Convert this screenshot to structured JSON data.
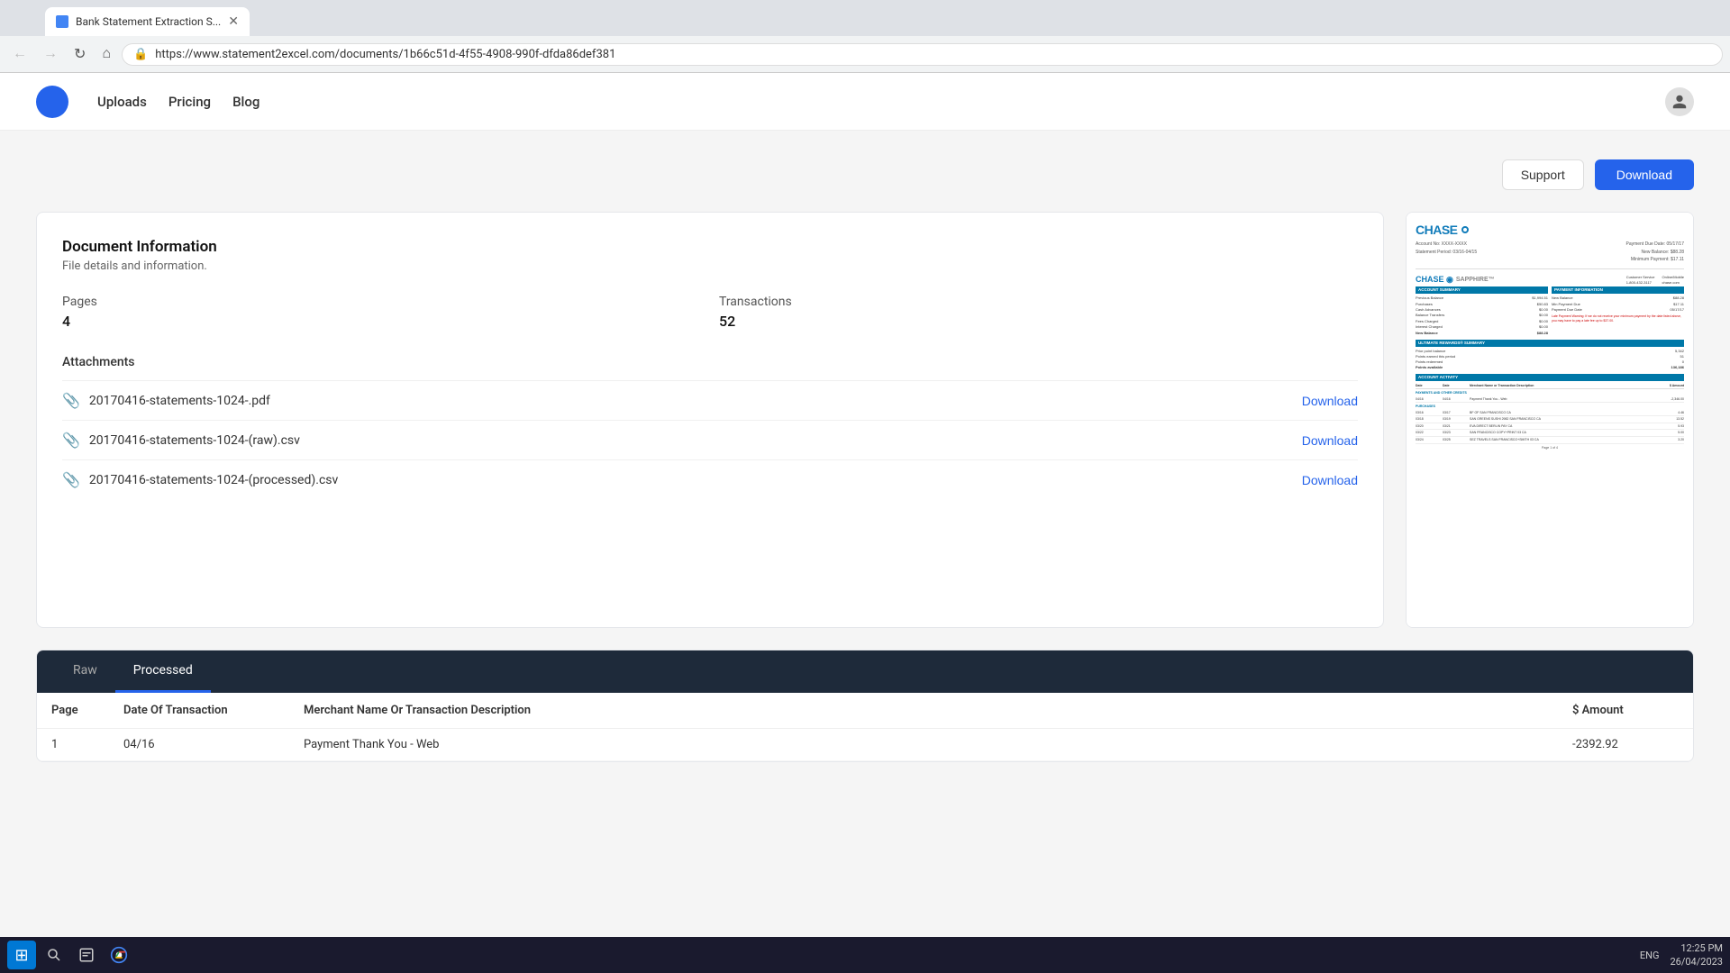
{
  "browser": {
    "tab_title": "Bank Statement Extraction S...",
    "url": "https://www.statement2excel.com/documents/1b66c51d-4f55-4908-990f-dfda86def381",
    "nav": {
      "back": "←",
      "forward": "→",
      "reload": "↻",
      "home": "⌂"
    }
  },
  "navbar": {
    "links": [
      {
        "id": "uploads",
        "label": "Uploads"
      },
      {
        "id": "pricing",
        "label": "Pricing"
      },
      {
        "id": "blog",
        "label": "Blog"
      }
    ]
  },
  "actions": {
    "support_label": "Support",
    "download_label": "Download"
  },
  "document": {
    "title": "Document Information",
    "subtitle": "File details and information.",
    "pages_label": "Pages",
    "pages_value": "4",
    "transactions_label": "Transactions",
    "transactions_value": "52",
    "attachments_title": "Attachments",
    "attachments": [
      {
        "id": "att1",
        "name": "20170416-statements-1024-.pdf",
        "download_label": "Download"
      },
      {
        "id": "att2",
        "name": "20170416-statements-1024-(raw).csv",
        "download_label": "Download"
      },
      {
        "id": "att3",
        "name": "20170416-statements-1024-(processed).csv",
        "download_label": "Download"
      }
    ]
  },
  "tabs": [
    {
      "id": "raw",
      "label": "Raw",
      "active": false
    },
    {
      "id": "processed",
      "label": "Processed",
      "active": true
    }
  ],
  "table": {
    "headers": [
      "Page",
      "Date Of Transaction",
      "Merchant Name Or Transaction Description",
      "$ Amount"
    ],
    "rows": [
      {
        "page": "1",
        "date": "04/16",
        "description": "Payment Thank You - Web",
        "amount": "-2392.92"
      }
    ]
  },
  "taskbar": {
    "time": "12:25 PM",
    "date": "26/04/2023",
    "lang": "ENG"
  }
}
